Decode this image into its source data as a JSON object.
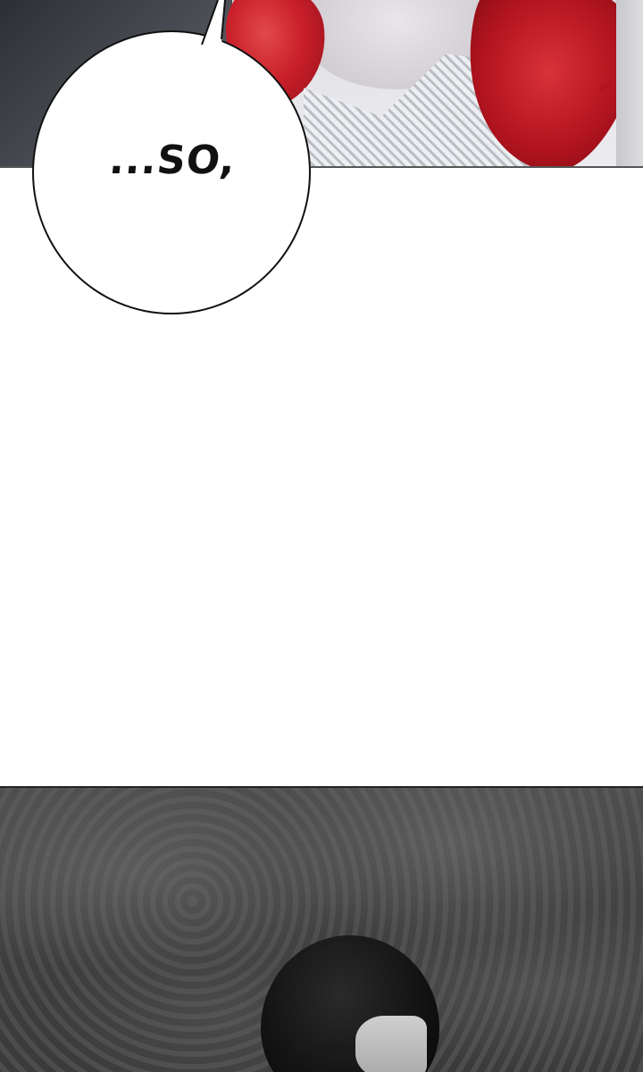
{
  "speech_bubble": {
    "text": "...SO,"
  }
}
